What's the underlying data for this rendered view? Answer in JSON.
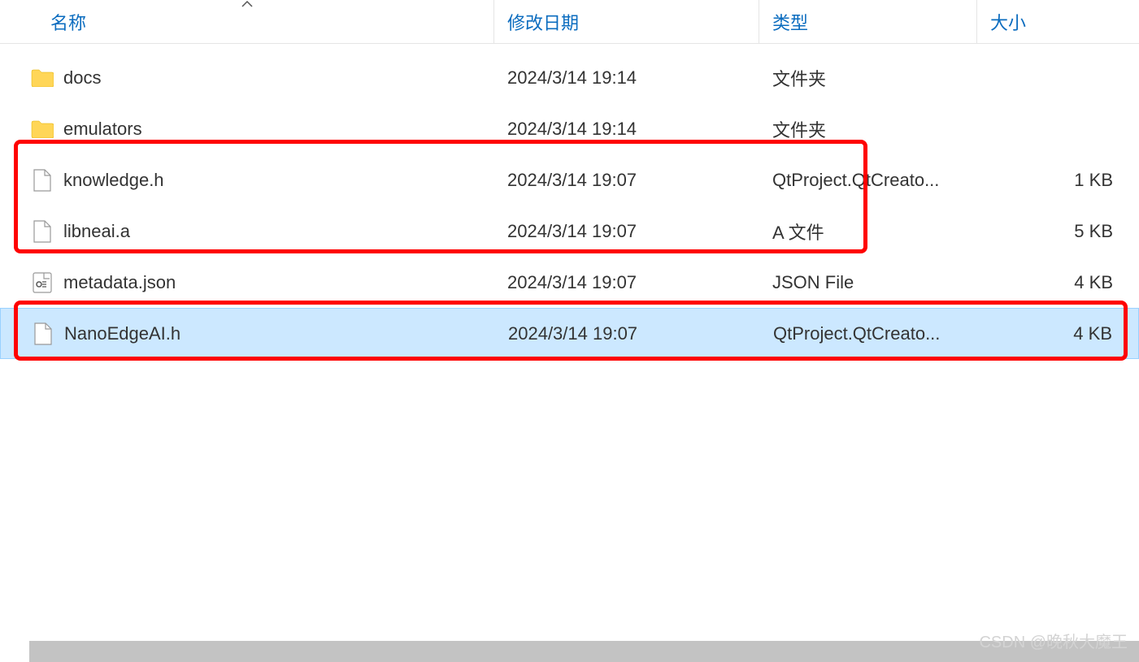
{
  "columns": {
    "name": "名称",
    "date": "修改日期",
    "type": "类型",
    "size": "大小"
  },
  "files": [
    {
      "icon": "folder",
      "name": "docs",
      "date": "2024/3/14 19:14",
      "type": "文件夹",
      "size": "",
      "selected": false
    },
    {
      "icon": "folder",
      "name": "emulators",
      "date": "2024/3/14 19:14",
      "type": "文件夹",
      "size": "",
      "selected": false
    },
    {
      "icon": "file",
      "name": "knowledge.h",
      "date": "2024/3/14 19:07",
      "type": "QtProject.QtCreato...",
      "size": "1 KB",
      "selected": false
    },
    {
      "icon": "file",
      "name": "libneai.a",
      "date": "2024/3/14 19:07",
      "type": "A 文件",
      "size": "5 KB",
      "selected": false
    },
    {
      "icon": "json",
      "name": "metadata.json",
      "date": "2024/3/14 19:07",
      "type": "JSON File",
      "size": "4 KB",
      "selected": false
    },
    {
      "icon": "file",
      "name": "NanoEdgeAI.h",
      "date": "2024/3/14 19:07",
      "type": "QtProject.QtCreato...",
      "size": "4 KB",
      "selected": true
    }
  ],
  "watermark": "CSDN @晚秋大魔王"
}
